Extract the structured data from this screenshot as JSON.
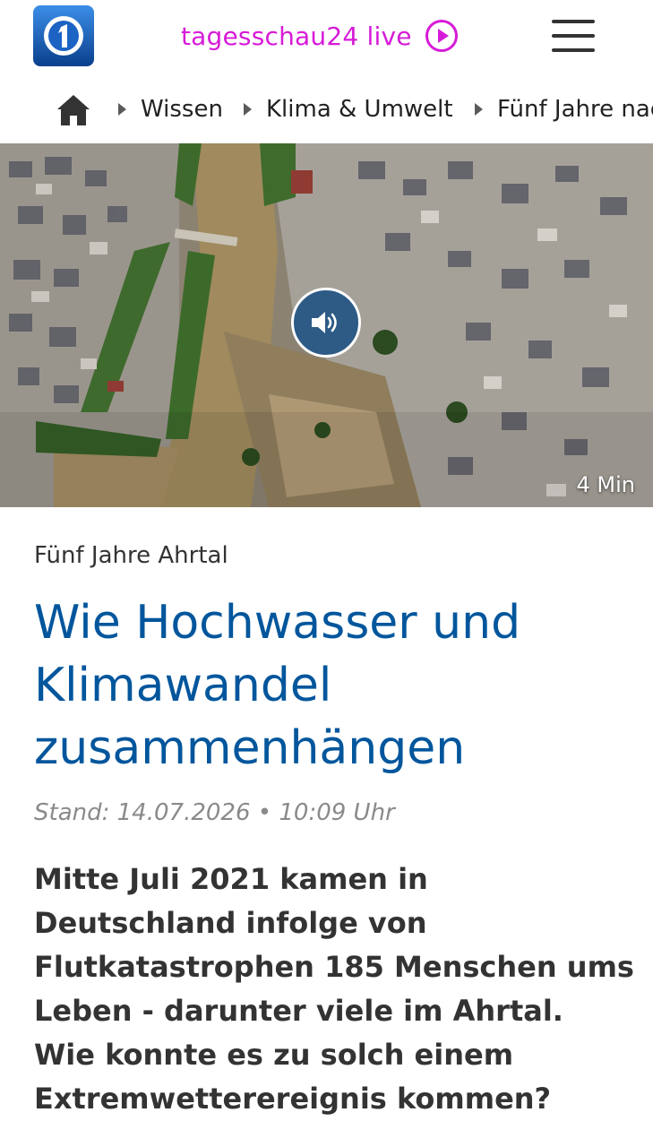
{
  "header": {
    "logo": "tagesschau-logo-icon",
    "live_label": "tagesschau24 live",
    "live_icon": "play-circle-icon",
    "menu_icon": "hamburger-menu-icon",
    "accent_color": "#d61bd8"
  },
  "breadcrumb": {
    "home_icon": "home-icon",
    "items": [
      {
        "label": "Wissen"
      },
      {
        "label": "Klima & Umwelt"
      },
      {
        "label": "Fünf Jahre nac"
      }
    ]
  },
  "hero": {
    "audio_icon": "speaker-icon",
    "duration": "4 Min"
  },
  "article": {
    "kicker": "Fünf Jahre Ahrtal",
    "title": "Wie Hochwasser und Klimawandel zusammenhängen",
    "meta": "Stand: 14.07.2026 • 10:09 Uhr",
    "lead": "Mitte Juli 2021 kamen in Deutschland infolge von Flutkatastrophen 185 Menschen ums Leben - darunter viele im Ahrtal. Wie konnte es zu solch einem Extremwetterereignis kommen?",
    "title_color": "#00569c"
  }
}
